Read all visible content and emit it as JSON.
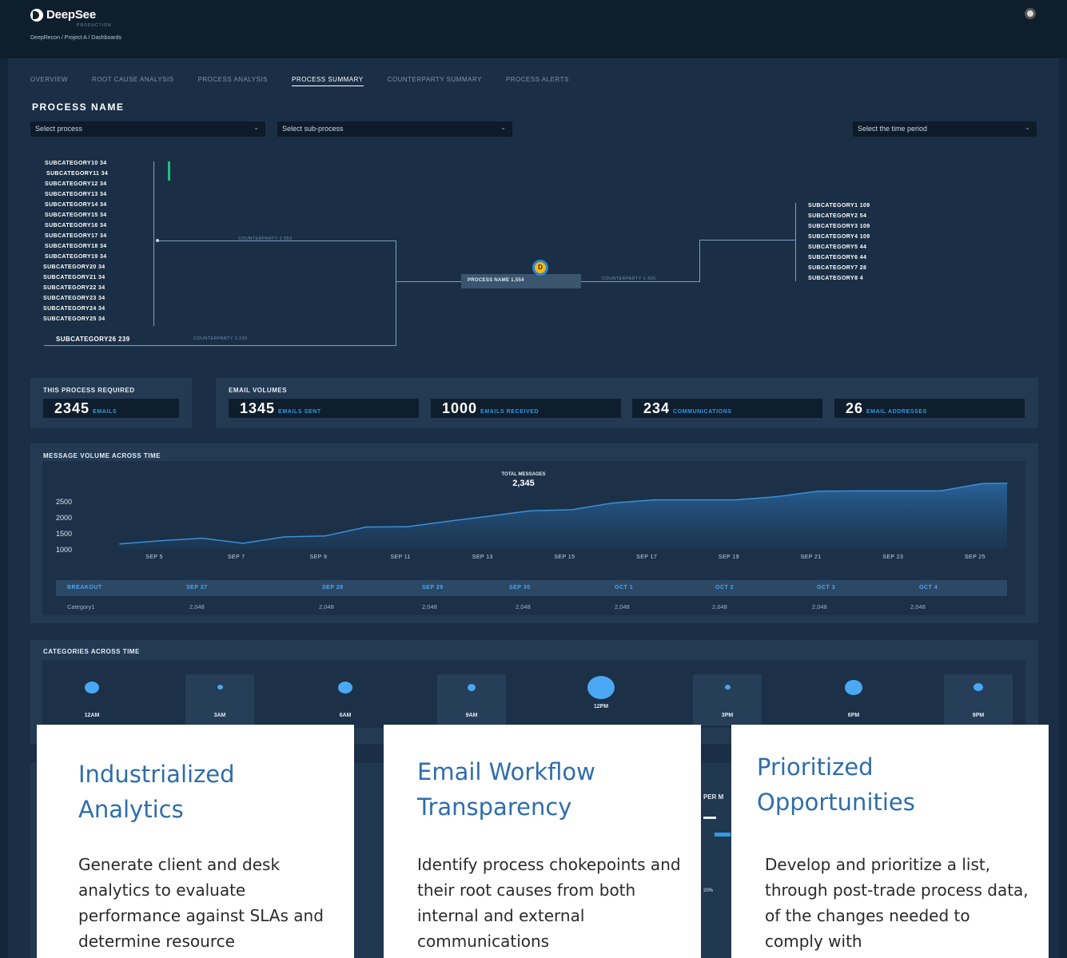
{
  "app": {
    "brand": "DeepSee",
    "environment": "PRODUCTION",
    "breadcrumb": "DeepRecon / Project A / Dashboards"
  },
  "icons": {
    "logo": "deepsee-logo-icon",
    "avatar": "user-avatar-icon",
    "chevron": "chevron-down-icon"
  },
  "colors": {
    "accent": "#2f9ae6",
    "bar_green": "#21c17a",
    "badge": "#f3b617",
    "card_title": "#2e6dab"
  },
  "tabs": [
    {
      "label": "OVERVIEW",
      "active": false
    },
    {
      "label": "ROOT CAUSE ANALYSIS",
      "active": false
    },
    {
      "label": "PROCESS ANALYSIS",
      "active": false
    },
    {
      "label": "PROCESS SUMMARY",
      "active": true
    },
    {
      "label": "COUNTERPARTY SUMMARY",
      "active": false
    },
    {
      "label": "PROCESS ALERTS",
      "active": false
    }
  ],
  "process": {
    "title": "PROCESS NAME",
    "select_process": "Select process",
    "select_subprocess": "Select sub-process",
    "select_period": "Select the time period"
  },
  "flow": {
    "left_items": [
      "SUBCATEGORY10  34",
      "SUBCATEGORY11  34",
      "SUBCATEGORY12  34",
      "SUBCATEGORY13  34",
      "SUBCATEGORY14  34",
      "SUBCATEGORY15  34",
      "SUBCATEGORY16  34",
      "SUBCATEGORY17  34",
      "SUBCATEGORY18  34",
      "SUBCATEGORY19  34",
      "SUBCATEGORY20  34",
      "SUBCATEGORY21  34",
      "SUBCATEGORY22  34",
      "SUBCATEGORY23  34",
      "SUBCATEGORY24  34",
      "SUBCATEGORY25  34"
    ],
    "bottom_item": "SUBCATEGORY26 239",
    "edge_cp2": "COUNTERPARTY 2 953",
    "edge_cp3": "COUNTERPARTY 3 239",
    "edge_cp1": "COUNTERPARTY 1 420",
    "center_node": "PROCESS NAME 1,554",
    "center_badge": "D",
    "right_items": [
      "SUBCATEGORY1  109",
      "SUBCATEGORY2  54",
      "SUBCATEGORY3  109",
      "SUBCATEGORY4  109",
      "SUBCATEGORY5  44",
      "SUBCATEGORY6  44",
      "SUBCATEGORY7  28",
      "SUBCATEGORY8  4"
    ]
  },
  "stats": {
    "required_title": "THIS PROCESS REQUIRED",
    "required_value": "2345",
    "required_label": "EMAILS",
    "volumes_title": "EMAIL  VOLUMES",
    "sent_value": "1345",
    "sent_label": "EMAILS SENT",
    "received_value": "1000",
    "received_label": "EMAILS RECEIVED",
    "comms_value": "234",
    "comms_label": "COMMUNICATIONS",
    "addr_value": "26",
    "addr_label": "EMAIL ADDRESSES"
  },
  "message_volume": {
    "title": "MESSAGE VOLUME ACROSS TIME",
    "total_label": "TOTAL MESSAGES",
    "total_value": "2,345",
    "breakout_headers": [
      "BREAKOUT",
      "SEP 27",
      "SEP 28",
      "SEP 29",
      "SEP 30",
      "OCT 1",
      "OCT 2",
      "OCT 3",
      "OCT 4"
    ],
    "breakout_row": [
      "Category1",
      "2,048",
      "2,048",
      "2,048",
      "2,048",
      "2,048",
      "2,048",
      "2,048",
      "2,048"
    ]
  },
  "chart_data": {
    "type": "area",
    "title": "",
    "xlabel": "",
    "ylabel": "",
    "y_ticks": [
      "2500",
      "2000",
      "1500",
      "1000"
    ],
    "x_ticks": [
      "SEP 5",
      "SEP 7",
      "SEP 9",
      "SEP 11",
      "SEP 13",
      "SEP 15",
      "SEP 17",
      "SEP 19",
      "SEP 21",
      "SEP 23",
      "SEP 25"
    ],
    "ylim": [
      1000,
      2500
    ],
    "x": [
      4,
      5,
      6,
      7,
      8,
      9,
      10,
      11,
      12,
      13,
      14,
      15,
      16,
      17,
      18,
      19,
      20,
      21,
      22,
      23,
      24,
      25,
      26
    ],
    "values": [
      1180,
      1280,
      1360,
      1200,
      1400,
      1430,
      1710,
      1720,
      1890,
      2050,
      2220,
      2250,
      2460,
      2560,
      2560,
      2560,
      2660,
      2830,
      2840,
      2840,
      2840,
      3070,
      3080
    ]
  },
  "categories_time": {
    "title": "CATEGORIES ACROSS TIME",
    "slots": [
      {
        "label": "12AM",
        "size": 18
      },
      {
        "label": "3AM",
        "size": 7
      },
      {
        "label": "6AM",
        "size": 18
      },
      {
        "label": "9AM",
        "size": 10
      },
      {
        "label": "12PM",
        "size": 34
      },
      {
        "label": "3PM",
        "size": 7
      },
      {
        "label": "6PM",
        "size": 22
      },
      {
        "label": "9PM",
        "size": 12
      }
    ],
    "partial_text": "PER M",
    "partial_pct": "20%"
  },
  "cards": [
    {
      "title": "Industrialized Analytics",
      "body": "Generate client and desk analytics to evaluate performance against SLAs and determine resource"
    },
    {
      "title": "Email Workflow Transparency",
      "body": "Identify process chokepoints and their root causes from both internal and external communications"
    },
    {
      "title": "Prioritized Opportunities",
      "body": "Develop and prioritize a list, through post-trade process data, of the changes needed to comply with"
    }
  ]
}
